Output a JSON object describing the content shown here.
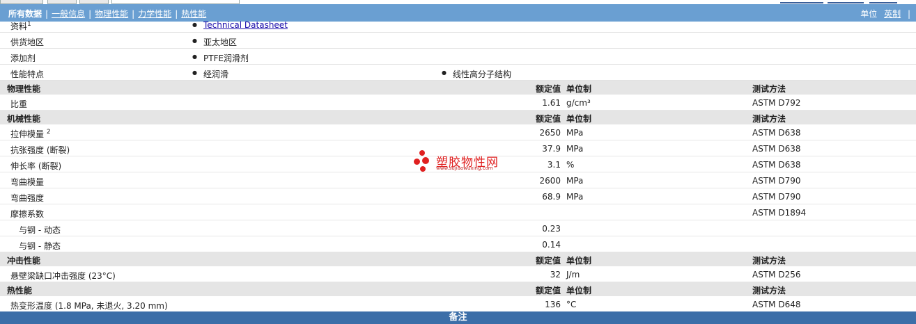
{
  "nav": {
    "all_label": "所有数据",
    "links": [
      "一般信息",
      "物理性能",
      "力学性能",
      "热性能"
    ],
    "units_label": "单位",
    "units_value": "英制"
  },
  "info": [
    {
      "label": "资料",
      "sup": "1",
      "items": [
        {
          "text": "Technical Datasheet",
          "link": true
        }
      ]
    },
    {
      "label": "供货地区",
      "items": [
        {
          "text": "亚太地区"
        }
      ]
    },
    {
      "label": "添加剂",
      "items": [
        {
          "text": "PTFE润滑剂"
        }
      ]
    },
    {
      "label": "性能特点",
      "items": [
        {
          "text": "经润滑"
        },
        {
          "text": "线性高分子结构"
        }
      ]
    }
  ],
  "header_cols": {
    "rated": "额定值",
    "unit": "单位制",
    "test": "测试方法"
  },
  "sections": [
    {
      "title": "物理性能",
      "rows": [
        {
          "label": "比重",
          "value": "1.61",
          "unit": "g/cm³",
          "test": "ASTM D792"
        }
      ]
    },
    {
      "title": "机械性能",
      "rows": [
        {
          "label": "拉伸模量",
          "sup": "2",
          "value": "2650",
          "unit": "MPa",
          "test": "ASTM D638"
        },
        {
          "label": "抗张强度 (断裂)",
          "value": "37.9",
          "unit": "MPa",
          "test": "ASTM D638"
        },
        {
          "label": "伸长率 (断裂)",
          "value": "3.1",
          "unit": "%",
          "test": "ASTM D638"
        },
        {
          "label": "弯曲模量",
          "value": "2600",
          "unit": "MPa",
          "test": "ASTM D790"
        },
        {
          "label": "弯曲强度",
          "value": "68.9",
          "unit": "MPa",
          "test": "ASTM D790"
        },
        {
          "label": "摩擦系数",
          "value": "",
          "unit": "",
          "test": "ASTM D1894"
        },
        {
          "label": "与钢 - 动态",
          "sub": true,
          "value": "0.23",
          "unit": "",
          "test": ""
        },
        {
          "label": "与钢 - 静态",
          "sub": true,
          "value": "0.14",
          "unit": "",
          "test": ""
        }
      ]
    },
    {
      "title": "冲击性能",
      "rows": [
        {
          "label": "悬壁梁缺口冲击强度 (23°C)",
          "value": "32",
          "unit": "J/m",
          "test": "ASTM D256"
        }
      ]
    },
    {
      "title": "热性能",
      "rows": [
        {
          "label": "热变形温度 (1.8 MPa, 未退火, 3.20 mm)",
          "value": "136",
          "unit": "°C",
          "test": "ASTM D648"
        }
      ]
    }
  ],
  "footer_label": "备注",
  "watermark": {
    "cn": "塑胶物性网",
    "en": "www.sujiaowuxing.com"
  }
}
